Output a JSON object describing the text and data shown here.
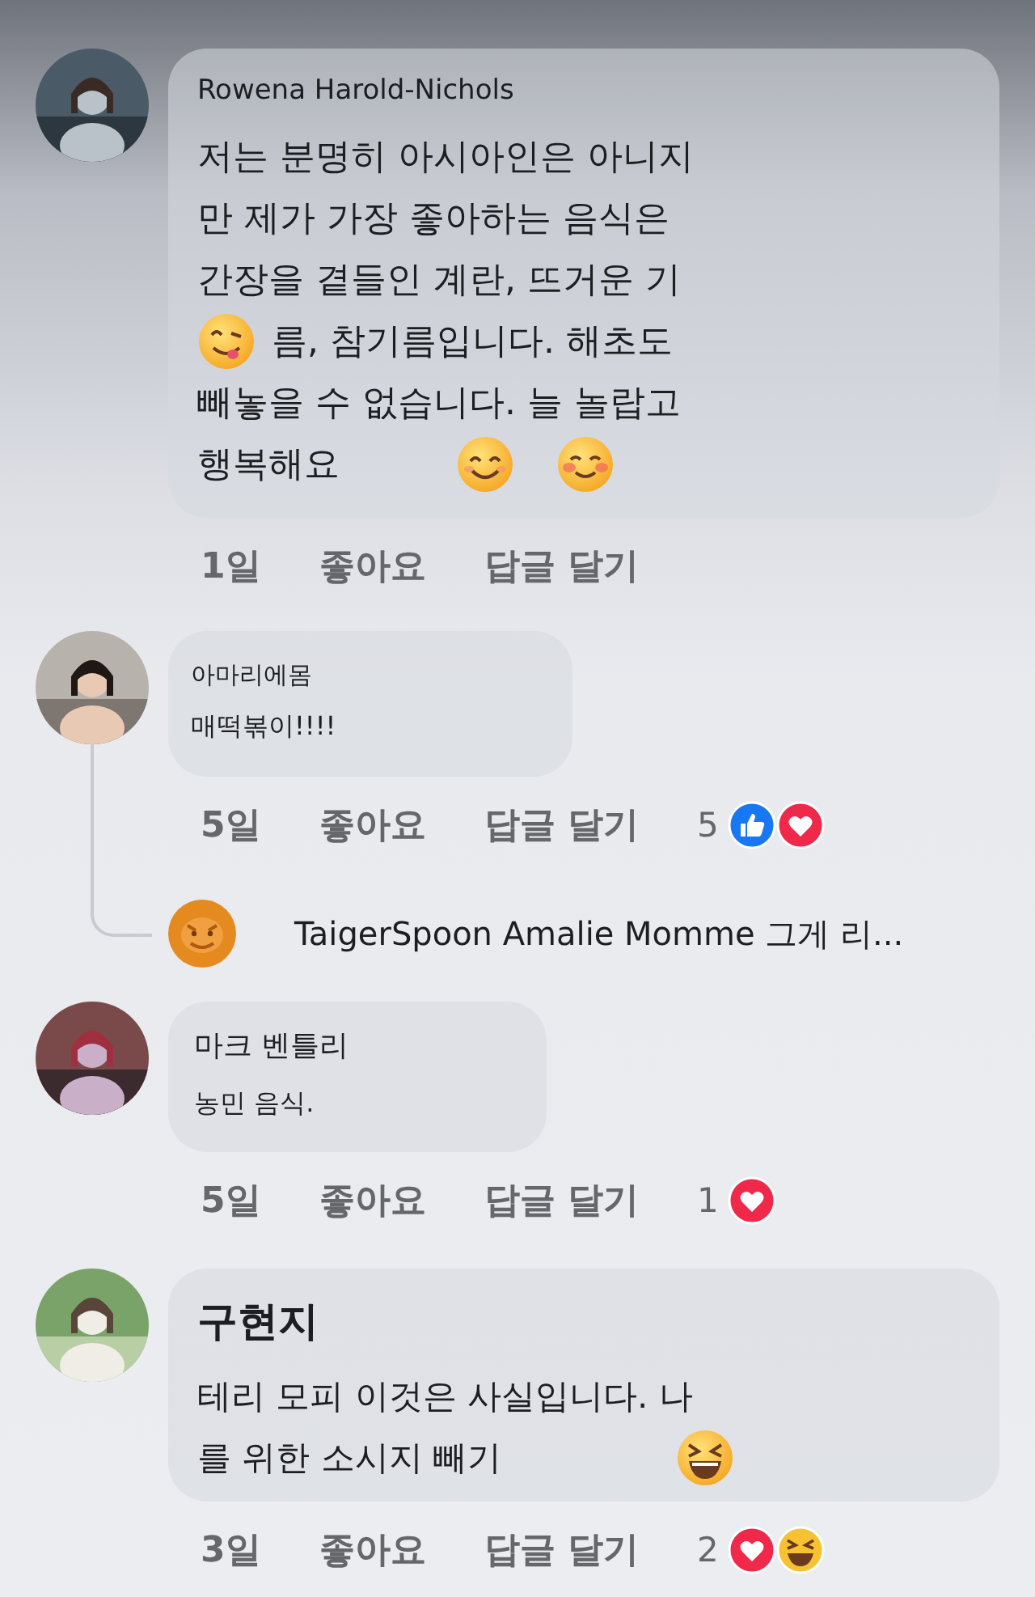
{
  "comments": [
    {
      "author": "Rowena Harold-Nichols",
      "lines": [
        {
          "text": "저는 분명히 아시아인은 아니지"
        },
        {
          "text": "만 제가 가장 좋아하는 음식은"
        },
        {
          "text": "간장을 곁들인 계란, 뜨거운 기"
        },
        {
          "emoji_before": [
            {
              "kind": "yum"
            }
          ],
          "text": "름, 참기름입니다. 해초도"
        },
        {
          "text": "빼놓을 수 없습니다. 늘 놀랍고"
        },
        {
          "text": "행복해요",
          "emoji_after": [
            {
              "kind": "smile"
            },
            {
              "kind": "blush"
            }
          ]
        }
      ],
      "time": "1일",
      "like": "좋아요",
      "reply": "답글 달기"
    },
    {
      "author": "아마리에몸",
      "lines": [
        {
          "text": "매떡볶이!!!!"
        }
      ],
      "time": "5일",
      "like": "좋아요",
      "reply": "답글 달기",
      "reaction_count": "5",
      "reactions": [
        {
          "kind": "like"
        },
        {
          "kind": "love"
        }
      ],
      "reply_preview": "TaigerSpoon Amalie Momme 그게 리..."
    },
    {
      "author": "마크 벤틀리",
      "lines": [
        {
          "text": "농민 음식."
        }
      ],
      "time": "5일",
      "like": "좋아요",
      "reply": "답글 달기",
      "reaction_count": "1",
      "reactions": [
        {
          "kind": "love"
        }
      ]
    },
    {
      "author": "구현지",
      "lines": [
        {
          "text": "테리 모피 이것은 사실입니다. 나"
        },
        {
          "text": "를 위한 소시지 빼기",
          "emoji_after": [
            {
              "kind": "laugh"
            }
          ]
        }
      ],
      "time": "3일",
      "like": "좋아요",
      "reply": "답글 달기",
      "reaction_count": "2",
      "reactions": [
        {
          "kind": "love"
        },
        {
          "kind": "haha"
        }
      ]
    }
  ]
}
